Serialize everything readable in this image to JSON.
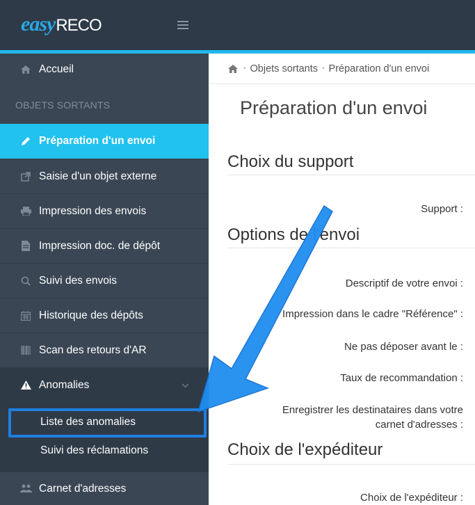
{
  "app": {
    "logo_main": "easy",
    "logo_sub": "RECO"
  },
  "sidebar": {
    "accueil": "Accueil",
    "section_header": "OBJETS SORTANTS",
    "items": [
      {
        "label": "Préparation d'un envoi",
        "icon": "pencil-icon"
      },
      {
        "label": "Saisie d'un objet externe",
        "icon": "external-link-icon"
      },
      {
        "label": "Impression des envois",
        "icon": "printer-icon"
      },
      {
        "label": "Impression doc. de dépôt",
        "icon": "document-icon"
      },
      {
        "label": "Suivi des envois",
        "icon": "search-icon"
      },
      {
        "label": "Historique des dépôts",
        "icon": "calendar-icon"
      },
      {
        "label": "Scan des retours d'AR",
        "icon": "barcode-icon"
      }
    ],
    "anomalies": "Anomalies",
    "sub_items": [
      "Liste des anomalies",
      "Suivi des réclamations"
    ],
    "carnet": "Carnet d'adresses"
  },
  "breadcrumb": {
    "level1": "Objets sortants",
    "level2": "Préparation d'un envoi"
  },
  "page": {
    "title": "Préparation d'un envoi",
    "sections": {
      "support": "Choix du support",
      "options": "Options de l'envoi",
      "expediteur": "Choix de l'expéditeur"
    },
    "labels": {
      "support": "Support :",
      "descriptif": "Descriptif de votre envoi :",
      "impression": "Impression dans le cadre \"Référence\" :",
      "ne_pas_deposer": "Ne pas déposer avant le :",
      "taux": "Taux de recommandation :",
      "enregistrer_1": "Enregistrer les destinataires dans votre",
      "enregistrer_2": "carnet d'adresses :",
      "choix_expediteur": "Choix de l'expéditeur :"
    }
  },
  "colors": {
    "accent": "#22c2ef",
    "sidebar": "#3a4654",
    "topbar": "#2e3a47",
    "arrow": "#1f8ef0"
  }
}
